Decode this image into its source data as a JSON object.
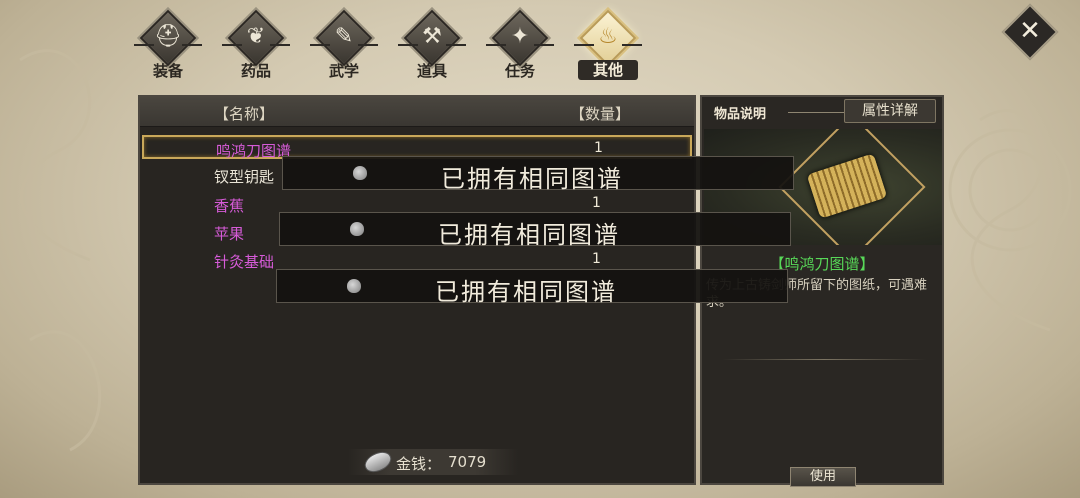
{
  "tabs": [
    {
      "label": "装备",
      "icon": "helmet-icon",
      "glyph": "⛑"
    },
    {
      "label": "药品",
      "icon": "potion-icon",
      "glyph": "❦"
    },
    {
      "label": "武学",
      "icon": "manual-icon",
      "glyph": "✎"
    },
    {
      "label": "道具",
      "icon": "chest-icon",
      "glyph": "⚒"
    },
    {
      "label": "任务",
      "icon": "task-icon",
      "glyph": "✦"
    },
    {
      "label": "其他",
      "icon": "flame-icon",
      "glyph": "♨"
    }
  ],
  "active_tab": "其他",
  "close_glyph": "✕",
  "list": {
    "header_name": "【名称】",
    "header_qty": "【数量】",
    "items": [
      {
        "name": "鸣鸿刀图谱",
        "qty": "1",
        "color": "#d65bd8",
        "selected": true
      },
      {
        "name": "钗型钥匙",
        "qty": "",
        "color": "#e9e4d6",
        "selected": false
      },
      {
        "name": "香蕉",
        "qty": "1",
        "color": "#d65bd8",
        "selected": false
      },
      {
        "name": "苹果",
        "qty": "",
        "color": "#d65bd8",
        "selected": false
      },
      {
        "name": "针灸基础",
        "qty": "1",
        "color": "#d65bd8",
        "selected": false
      }
    ]
  },
  "money": {
    "label": "金钱：",
    "value": "7079"
  },
  "detail": {
    "tab_description": "物品说明",
    "tab_attributes": "属性详解",
    "item_name": "【鸣鸿刀图谱】",
    "description": "传为上古铸剑师所留下的图纸，可遇难求。",
    "use_label": "使用"
  },
  "toasts": [
    {
      "text": "已拥有相同图谱"
    },
    {
      "text": "已拥有相同图谱"
    },
    {
      "text": "已拥有相同图谱"
    }
  ],
  "colors": {
    "rare_item": "#d65bd8",
    "common_item": "#e9e4d6",
    "detail_name": "#58d858",
    "highlight_border": "#c9a85a"
  }
}
